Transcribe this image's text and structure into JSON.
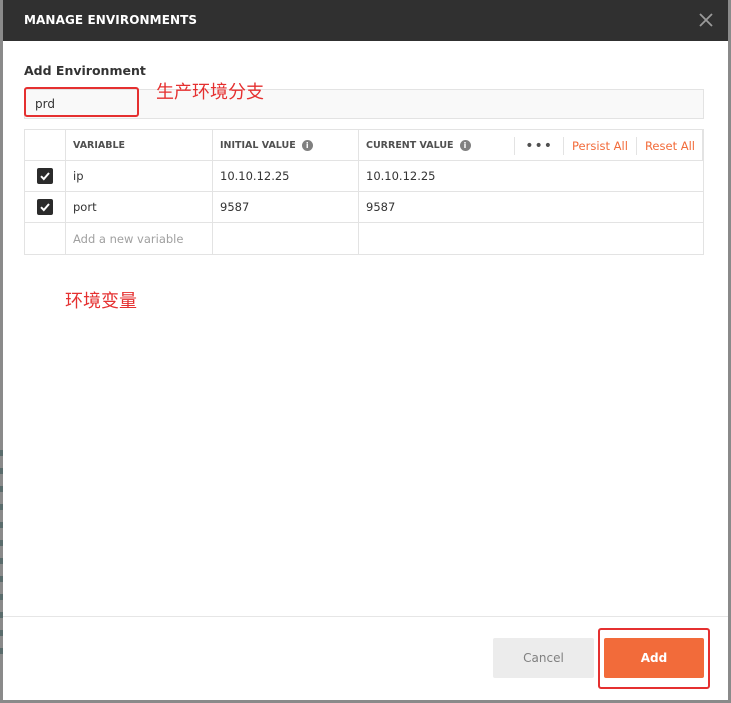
{
  "modal": {
    "title": "MANAGE ENVIRONMENTS",
    "section_label": "Add Environment",
    "env_name_value": "prd"
  },
  "annotations": {
    "env_branch": "生产环境分支",
    "env_vars": "环境变量"
  },
  "table": {
    "headers": {
      "variable": "VARIABLE",
      "initial_value": "INITIAL VALUE",
      "current_value": "CURRENT VALUE",
      "info_glyph": "i",
      "more": "•••",
      "persist_all": "Persist All",
      "reset_all": "Reset All"
    },
    "rows": [
      {
        "variable": "ip",
        "initial_value": "10.10.12.25",
        "current_value": "10.10.12.25",
        "checked": true
      },
      {
        "variable": "port",
        "initial_value": "9587",
        "current_value": "9587",
        "checked": true
      }
    ],
    "new_variable_placeholder": "Add a new variable"
  },
  "footer": {
    "cancel_label": "Cancel",
    "add_label": "Add"
  },
  "colors": {
    "accent": "#f26b3a",
    "annotation_red": "#e53030",
    "header_bg": "#303030"
  }
}
